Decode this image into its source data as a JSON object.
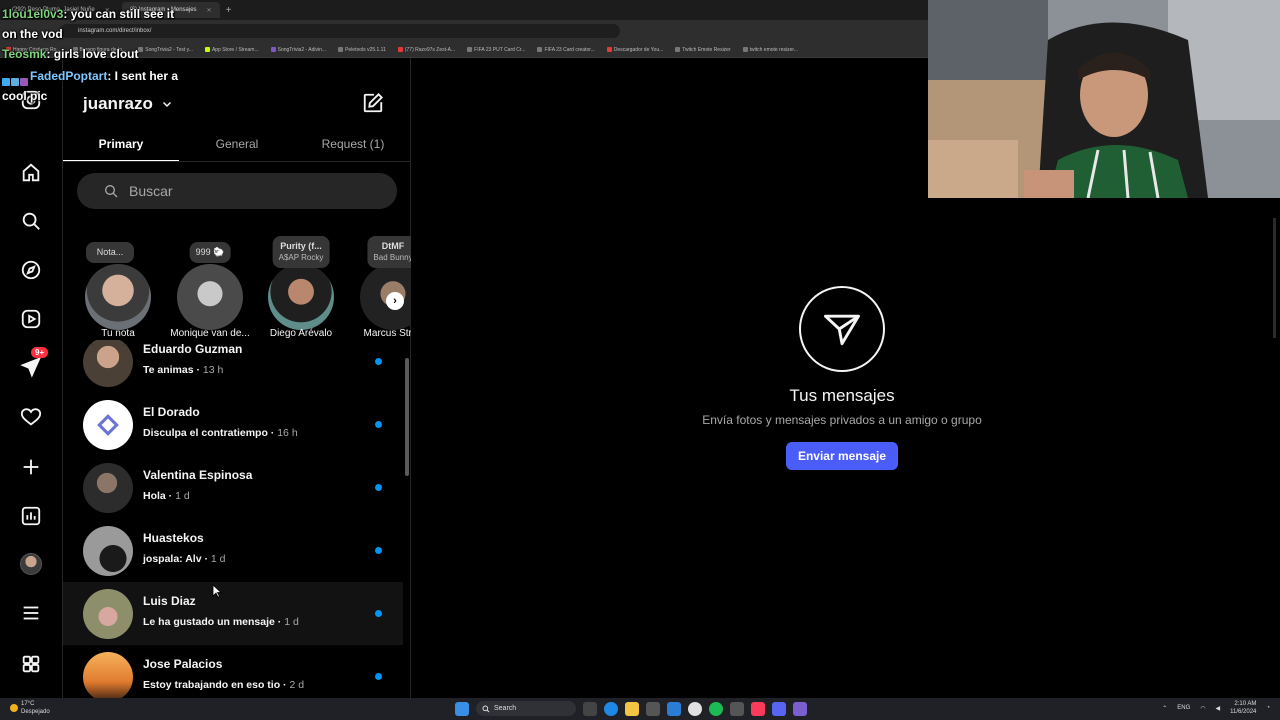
{
  "browser": {
    "tabs": [
      {
        "label": "(292) Peso Pluma, Jasiel Nuñe",
        "active": false
      },
      {
        "label": "(6) Instagram • Mensajes",
        "active": true
      }
    ],
    "url": "instagram.com/direct/inbox/",
    "bookmarks": [
      "Happy Cristiano Ro...",
      "Burago figura de to...",
      "SongTrivia2 - Test y...",
      "App Store / Stream...",
      "SongTrivia2 - Adivin...",
      "Peletools v25.1.11",
      "(77) Razo97s Zest-A...",
      "FIFA 23 PUT Card Cr...",
      "FIFA 23 Card creator...",
      "Descargador de You...",
      "Twitch Emote Resizer",
      "twitch emote resizer..."
    ]
  },
  "chat": [
    {
      "user": "1lou1el0v3",
      "message": ": you can still see it",
      "color": "green"
    },
    {
      "user": "",
      "message": "on the vod",
      "color": "white"
    },
    {
      "user": "Teosmk",
      "message": ": girls love clout",
      "color": "green"
    },
    {
      "user": "FadedPoptart",
      "message": ": I sent her a",
      "color": "blue"
    },
    {
      "user": "",
      "message": "cool pic",
      "color": "white"
    }
  ],
  "nav": {
    "items": [
      "home",
      "search",
      "explore",
      "reels",
      "messages",
      "notifications",
      "create",
      "dashboard",
      "profile",
      "more",
      "threads"
    ],
    "messages_badge": "9+"
  },
  "inbox": {
    "username": "juanrazo",
    "tabs": [
      {
        "label": "Primary",
        "active": true
      },
      {
        "label": "General",
        "active": false
      },
      {
        "label": "Request (1)",
        "active": false
      }
    ],
    "search_placeholder": "Buscar",
    "notes": [
      {
        "bubble": "Nota...",
        "sub": "",
        "name": "Tu nota"
      },
      {
        "bubble": "999 🐑",
        "sub": "",
        "name": "Monique van de..."
      },
      {
        "bubble": "Purity (f...",
        "sub": "A$AP Rocky",
        "name": "Diego Arévalo"
      },
      {
        "bubble": "DtMF",
        "sub": "Bad Bunny",
        "name": "Marcus Strac"
      }
    ],
    "threads": [
      {
        "name": "Eduardo Guzman",
        "message": "Te animas",
        "time": "13 h",
        "unread": true
      },
      {
        "name": "El Dorado",
        "message": "Disculpa el contratiempo",
        "time": "16 h",
        "unread": true
      },
      {
        "name": "Valentina Espinosa",
        "message": "Hola",
        "time": "1 d",
        "unread": true
      },
      {
        "name": "Huastekos",
        "message": "jospala: Alv",
        "time": "1 d",
        "unread": true
      },
      {
        "name": "Luis Diaz",
        "message": "Le ha gustado un mensaje",
        "time": "1 d",
        "unread": true
      },
      {
        "name": "Jose Palacios",
        "message": "Estoy trabajando en eso tio",
        "time": "2 d",
        "unread": true
      }
    ]
  },
  "main": {
    "title": "Tus mensajes",
    "subtitle": "Envía fotos y mensajes privados a un amigo o grupo",
    "button": "Enviar mensaje"
  },
  "taskbar": {
    "temp": "17°C",
    "weather": "Despejado",
    "search": "Search",
    "lang": "ENG",
    "time": "2:10 AM",
    "date": "11/6/2024"
  },
  "colors": {
    "accent": "#4a5df9",
    "unread_dot": "#0095f6",
    "badge": "#ff3040"
  }
}
